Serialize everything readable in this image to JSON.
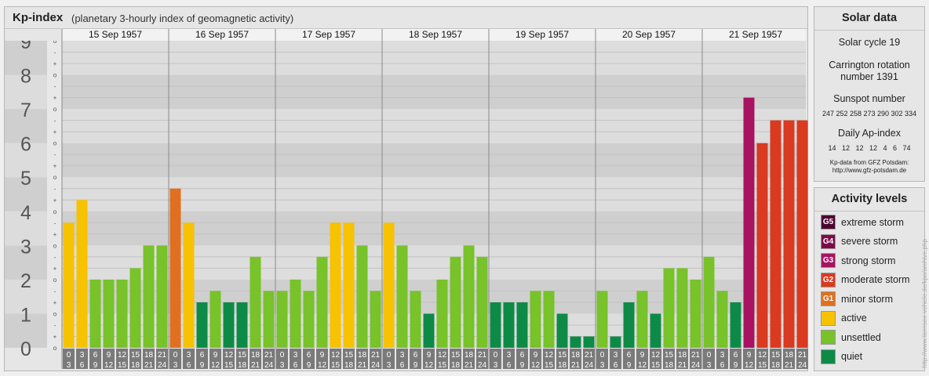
{
  "header": {
    "title": "Kp-index",
    "subtitle": "(planetary 3-hourly index of geomagnetic activity)"
  },
  "colors": {
    "extreme": "#4c0531",
    "severe": "#7c0c48",
    "strong": "#a81361",
    "moderate": "#d93a20",
    "minor": "#e0701f",
    "active": "#f7c200",
    "unsettled": "#78c22a",
    "quiet": "#0e8a47"
  },
  "chart_data": {
    "type": "bar",
    "ylim": [
      0,
      9
    ],
    "y_ticks": [
      "0",
      "1",
      "2",
      "3",
      "4",
      "5",
      "6",
      "7",
      "8",
      "9"
    ],
    "minor_tick_marks": [
      "o",
      "+",
      "-"
    ],
    "days": [
      "15 Sep 1957",
      "16 Sep 1957",
      "17 Sep 1957",
      "18 Sep 1957",
      "19 Sep 1957",
      "20 Sep 1957",
      "21 Sep 1957"
    ],
    "interval_labels": [
      [
        "0",
        "3"
      ],
      [
        "3",
        "6"
      ],
      [
        "6",
        "9"
      ],
      [
        "9",
        "12"
      ],
      [
        "12",
        "15"
      ],
      [
        "15",
        "18"
      ],
      [
        "18",
        "21"
      ],
      [
        "21",
        "24"
      ]
    ],
    "values": [
      [
        3.667,
        4.333,
        2.0,
        2.0,
        2.0,
        2.333,
        3.0,
        3.0
      ],
      [
        4.667,
        3.667,
        1.333,
        1.667,
        1.333,
        1.333,
        2.667,
        1.667
      ],
      [
        1.667,
        2.0,
        1.667,
        2.667,
        3.667,
        3.667,
        3.0,
        1.667
      ],
      [
        3.667,
        3.0,
        1.667,
        1.0,
        2.0,
        2.667,
        3.0,
        2.667
      ],
      [
        1.333,
        1.333,
        1.333,
        1.667,
        1.667,
        1.0,
        0.333,
        0.333
      ],
      [
        1.667,
        0.333,
        1.333,
        1.667,
        1.0,
        2.333,
        2.333,
        2.0
      ],
      [
        2.667,
        1.667,
        1.333,
        7.333,
        6.0,
        6.667,
        6.667,
        6.667
      ]
    ]
  },
  "solar_data": {
    "title": "Solar data",
    "solar_cycle": "Solar cycle 19",
    "carrington_line1": "Carrington rotation",
    "carrington_line2": "number 1391",
    "sunspot_title": "Sunspot number",
    "sunspot_values": "247 252 258 273 290 302 334",
    "ap_title": "Daily Ap-index",
    "ap_values": "14   12   12   12   4   6   74",
    "source_line1": "Kp-data from GFZ Potsdam:",
    "source_line2": "http://www.gfz-potsdam.de"
  },
  "activity_levels": {
    "title": "Activity levels",
    "items": [
      {
        "code": "G5",
        "label": "extreme storm",
        "color": "#4c0531"
      },
      {
        "code": "G4",
        "label": "severe storm",
        "color": "#7c0c48"
      },
      {
        "code": "G3",
        "label": "strong storm",
        "color": "#a81361"
      },
      {
        "code": "G2",
        "label": "moderate storm",
        "color": "#d93a20"
      },
      {
        "code": "G1",
        "label": "minor storm",
        "color": "#e0701f"
      },
      {
        "code": "",
        "label": "active",
        "color": "#f7c200"
      },
      {
        "code": "",
        "label": "unsettled",
        "color": "#78c22a"
      },
      {
        "code": "",
        "label": "quiet",
        "color": "#0e8a47"
      }
    ]
  },
  "watermark": "http://www.tiernsee-vehicle.de/kpo/archive.php"
}
